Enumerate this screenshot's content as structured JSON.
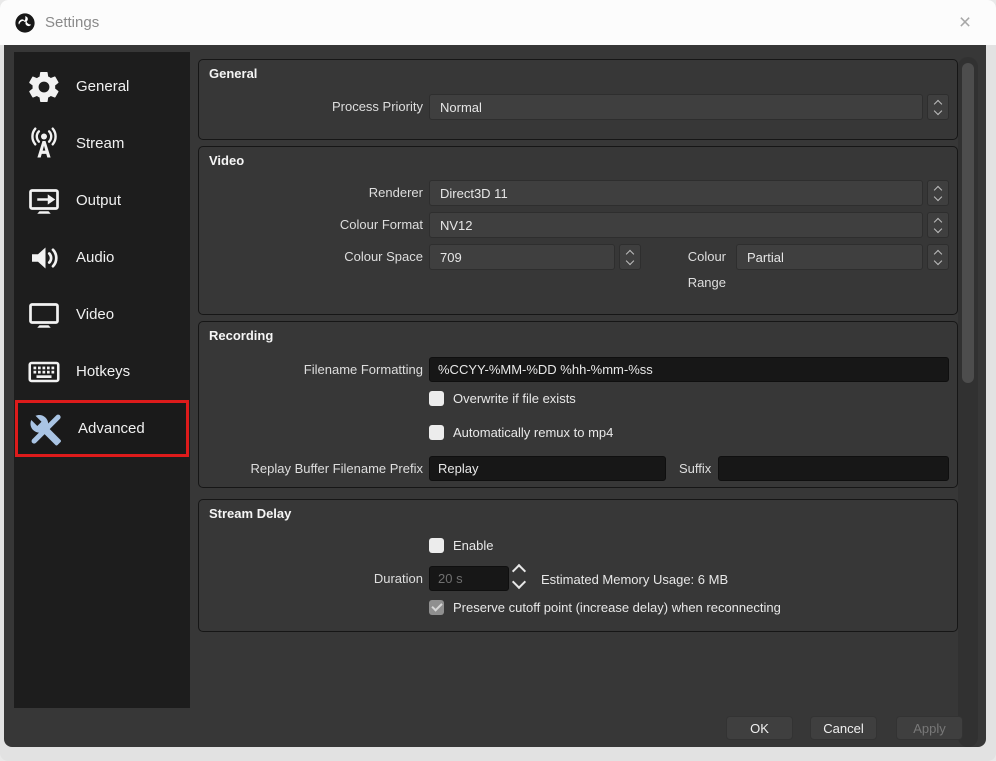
{
  "window": {
    "title": "Settings",
    "close_glyph": "×"
  },
  "sidebar": {
    "selected": "Advanced",
    "items": [
      {
        "label": "General",
        "icon": "gear-icon"
      },
      {
        "label": "Stream",
        "icon": "broadcast-antenna-icon"
      },
      {
        "label": "Output",
        "icon": "monitor-arrow-icon"
      },
      {
        "label": "Audio",
        "icon": "speaker-icon"
      },
      {
        "label": "Video",
        "icon": "monitor-icon"
      },
      {
        "label": "Hotkeys",
        "icon": "keyboard-icon"
      },
      {
        "label": "Advanced",
        "icon": "tools-icon"
      }
    ]
  },
  "sections": {
    "general": {
      "title": "General",
      "process_priority": {
        "label": "Process Priority",
        "value": "Normal"
      }
    },
    "video": {
      "title": "Video",
      "renderer": {
        "label": "Renderer",
        "value": "Direct3D 11"
      },
      "colour_format": {
        "label": "Colour Format",
        "value": "NV12"
      },
      "colour_space": {
        "label": "Colour Space",
        "value": "709"
      },
      "colour_range": {
        "label": "Colour Range",
        "value": "Partial"
      }
    },
    "recording": {
      "title": "Recording",
      "filename_formatting": {
        "label": "Filename Formatting",
        "value": "%CCYY-%MM-%DD %hh-%mm-%ss"
      },
      "overwrite": {
        "label": "Overwrite if file exists",
        "checked": false
      },
      "remux": {
        "label": "Automatically remux to mp4",
        "checked": false
      },
      "replay_prefix": {
        "label": "Replay Buffer Filename Prefix",
        "value": "Replay"
      },
      "suffix": {
        "label": "Suffix",
        "value": ""
      }
    },
    "stream_delay": {
      "title": "Stream Delay",
      "enable": {
        "label": "Enable",
        "checked": false
      },
      "duration": {
        "label": "Duration",
        "value": "20 s",
        "disabled": true
      },
      "memory_usage": "Estimated Memory Usage: 6 MB",
      "preserve": {
        "label": "Preserve cutoff point (increase delay) when reconnecting",
        "checked": true,
        "disabled": true
      }
    }
  },
  "footer": {
    "ok": "OK",
    "cancel": "Cancel",
    "apply": "Apply"
  },
  "colors": {
    "annotation_red": "#dd1b1b",
    "selected_icon_blue": "#a9c4e4",
    "content_bg": "#373737",
    "sidebar_bg": "#1d1d1d",
    "input_bg": "#171717",
    "combo_bg": "#3f3f3f",
    "titlebar_bg": "#fcfcfc"
  }
}
